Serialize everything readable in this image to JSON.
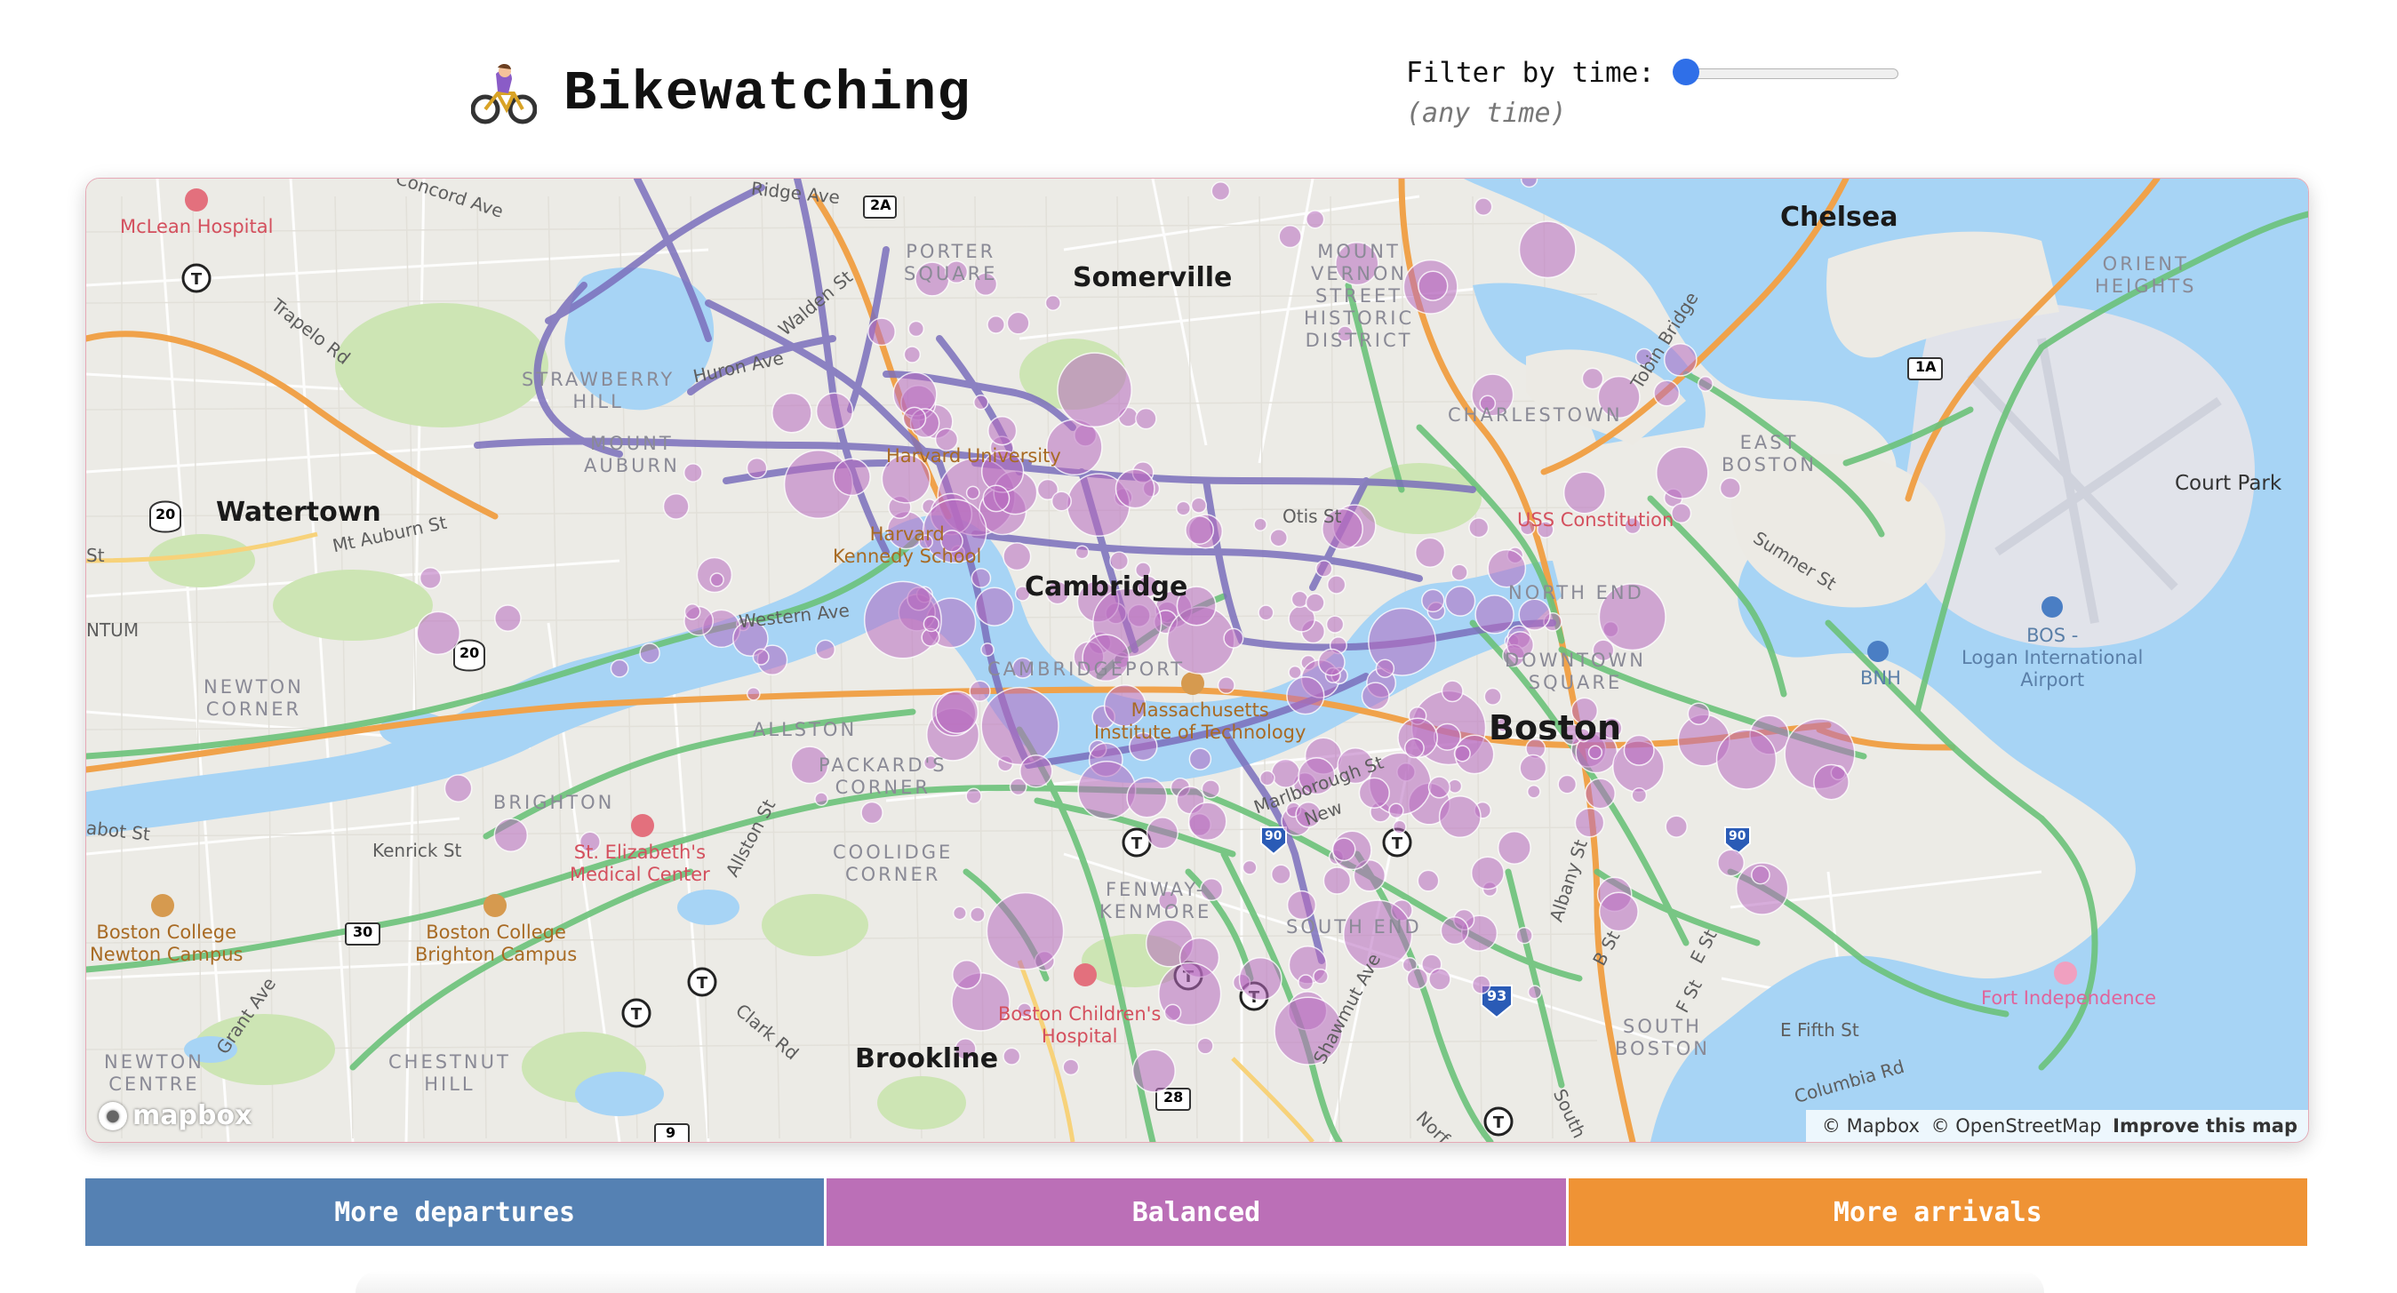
{
  "header": {
    "title": "Bikewatching",
    "icon": "person-biking-icon",
    "filter_label": "Filter by time:",
    "filter_value": "(any time)",
    "filter_slider_level": 0,
    "slider_color": "#2f6fe8"
  },
  "map": {
    "labels": {
      "chelsea": "Chelsea",
      "somerville": "Somerville",
      "watertown": "Watertown",
      "cambridge": "Cambridge",
      "boston": "Boston",
      "brookline": "Brookline",
      "court_park": "Court Park",
      "porter_square": "PORTER\nSQUARE",
      "mount_vernon": "MOUNT\nVERNON\nSTREET\nHISTORIC\nDISTRICT",
      "charlestown": "CHARLESTOWN",
      "east_boston": "EAST\nBOSTON",
      "orient_heights": "ORIENT\nHEIGHTS",
      "strawberry_hill": "STRAWBERRY\nHILL",
      "mount_auburn": "MOUNT\nAUBURN",
      "north_end": "NORTH END",
      "newton_corner": "NEWTON\nCORNER",
      "allston": "ALLSTON",
      "packards_corner": "PACKARD'S\nCORNER",
      "brighton": "BRIGHTON",
      "coolidge_corner": "COOLIDGE\nCORNER",
      "fenway_kenmore": "FENWAY-\nKENMORE",
      "south_end": "SOUTH END",
      "south_boston": "SOUTH\nBOSTON",
      "newton_centre": "NEWTON\nCENTRE",
      "chestnut_hill": "CHESTNUT\nHILL",
      "cambridgeport": "CAMBRIDGEPORT",
      "beacon_hill": "DOWNTOWN\nSQUARE",
      "mclean": "McLean Hospital",
      "harvard": "Harvard University",
      "kennedy": "Harvard\nKennedy School",
      "mit": "Massachusetts\nInstitute of Technology",
      "st_elizabeth": "St. Elizabeth's\nMedical Center",
      "bc_newton": "Boston College\nNewton Campus",
      "bc_brighton": "Boston College\nBrighton Campus",
      "childrens": "Boston Children's\nHospital",
      "uss": "USS Constitution",
      "logan": "BOS -\nLogan International\nAirport",
      "bnh": "BNH",
      "fort": "Fort Independence",
      "concord_ave": "Concord Ave",
      "trapelo_rd": "Trapelo Rd",
      "ridge_ave": "Ridge Ave",
      "huron_ave": "Huron Ave",
      "walden_st": "Walden St",
      "mt_auburn_st": "Mt Auburn St",
      "western_ave": "Western Ave",
      "kenrick_st": "Kenrick St",
      "allston_st": "Allston St",
      "abot_st": "abot St",
      "grant_ave": "Grant Ave",
      "clark_rd": "Clark Rd",
      "marlborough_st": "Marlborough St",
      "albany_st": "Albany St",
      "sumner_st": "Sumner St",
      "tobin_bridge": "Tobin Bridge",
      "b_st": "B St",
      "e_st": "E St",
      "f_st": "F St",
      "e_fifth_st": "E Fifth St",
      "columbia_rd": "Columbia Rd",
      "shawmut_ave": "Shawmut Ave",
      "ntum": "NTUM",
      "st": "St",
      "south": "South",
      "norf": "Norf",
      "otis_st": "Otis St",
      "new": "New",
      "route_20a": "20",
      "route_20b": "20",
      "route_2a": "2A",
      "route_1a": "1A",
      "route_30": "30",
      "route_28": "28",
      "route_9": "9",
      "route_90a": "90",
      "route_90b": "90",
      "route_93": "93"
    },
    "station_color": "#b86bc0",
    "bike_lane_color": "#7b6fbc",
    "green_path_color": "#6cc27a",
    "highway_color": "#f0a24a",
    "water_color": "#a7d4f5",
    "logo": "mapbox",
    "attribution": {
      "mapbox": "© Mapbox",
      "osm": "© OpenStreetMap",
      "improve": "Improve this map"
    }
  },
  "legend": {
    "items": [
      {
        "label": "More departures",
        "color": "#5581b3"
      },
      {
        "label": "Balanced",
        "color": "#bb6fb7"
      },
      {
        "label": "More arrivals",
        "color": "#ef9335"
      }
    ]
  }
}
